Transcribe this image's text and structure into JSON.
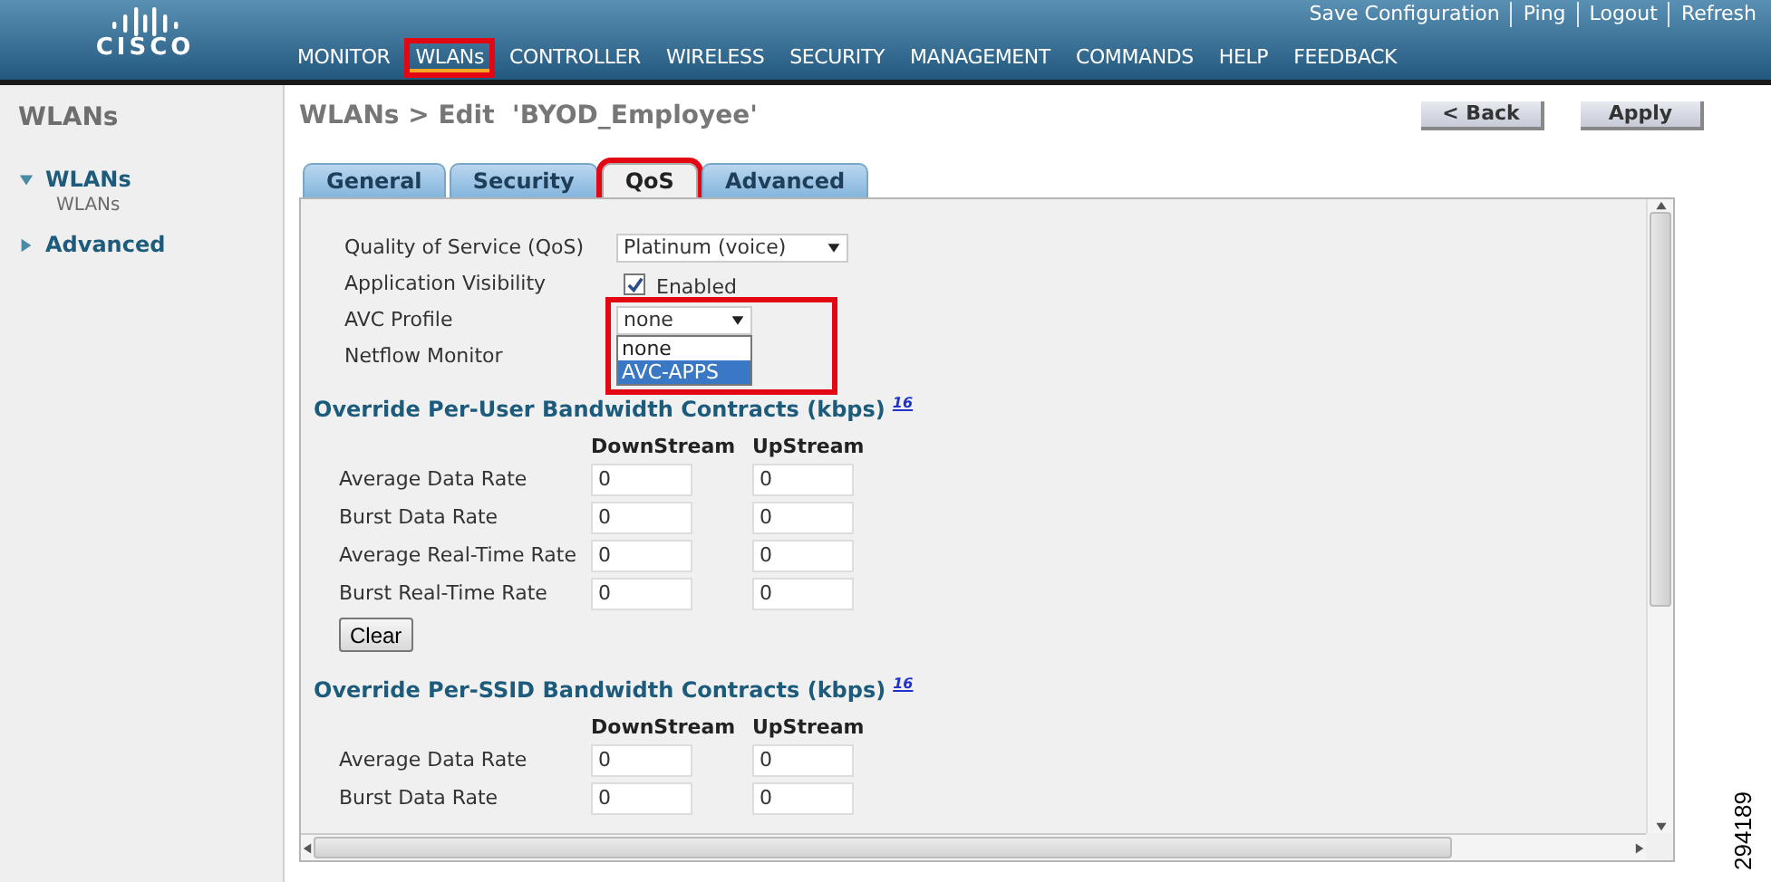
{
  "header": {
    "logo": "CISCO",
    "utility_links": [
      "Save Configuration",
      "Ping",
      "Logout",
      "Refresh"
    ],
    "nav": [
      {
        "label": "MONITOR",
        "selected": false,
        "highlighted": false
      },
      {
        "label": "WLANs",
        "selected": true,
        "highlighted": true
      },
      {
        "label": "CONTROLLER",
        "selected": false,
        "highlighted": false
      },
      {
        "label": "WIRELESS",
        "selected": false,
        "highlighted": false
      },
      {
        "label": "SECURITY",
        "selected": false,
        "highlighted": false
      },
      {
        "label": "MANAGEMENT",
        "selected": false,
        "highlighted": false
      },
      {
        "label": "COMMANDS",
        "selected": false,
        "highlighted": false
      },
      {
        "label": "HELP",
        "selected": false,
        "highlighted": false
      },
      {
        "label": "FEEDBACK",
        "selected": false,
        "highlighted": false
      }
    ]
  },
  "sidebar": {
    "title": "WLANs",
    "items": [
      {
        "label": "WLANs",
        "expanded": true,
        "children": [
          {
            "label": "WLANs"
          }
        ]
      },
      {
        "label": "Advanced",
        "expanded": false
      }
    ]
  },
  "page": {
    "title": "WLANs > Edit  'BYOD_Employee'",
    "buttons": [
      "< Back",
      "Apply"
    ],
    "tabs": [
      {
        "label": "General",
        "selected": false,
        "highlighted": false
      },
      {
        "label": "Security",
        "selected": false,
        "highlighted": false
      },
      {
        "label": "QoS",
        "selected": true,
        "highlighted": true
      },
      {
        "label": "Advanced",
        "selected": false,
        "highlighted": false
      }
    ],
    "form": [
      {
        "kind": "select",
        "label": "Quality of Service (QoS)",
        "value": "Platinum (voice)"
      },
      {
        "kind": "checkbox",
        "label": "Application Visibility",
        "checked": true,
        "text": "Enabled"
      },
      {
        "kind": "select",
        "label": "AVC Profile",
        "value": "none",
        "expanded": true,
        "highlighted": true,
        "options": [
          {
            "label": "none",
            "highlighted": false
          },
          {
            "label": "AVC-APPS",
            "highlighted": true
          }
        ]
      },
      {
        "kind": "covered",
        "label": "Netflow Monitor"
      }
    ],
    "sections": [
      {
        "title": "Override Per-User Bandwidth Contracts (kbps)",
        "note": "16",
        "columns": [
          "DownStream",
          "UpStream"
        ],
        "rows": [
          {
            "label": "Average Data Rate",
            "values": [
              "0",
              "0"
            ]
          },
          {
            "label": "Burst Data Rate",
            "values": [
              "0",
              "0"
            ]
          },
          {
            "label": "Average Real-Time Rate",
            "values": [
              "0",
              "0"
            ]
          },
          {
            "label": "Burst Real-Time Rate",
            "values": [
              "0",
              "0"
            ]
          }
        ],
        "button": "Clear"
      },
      {
        "title": "Override Per-SSID Bandwidth Contracts (kbps)",
        "note": "16",
        "columns": [
          "DownStream",
          "UpStream"
        ],
        "rows": [
          {
            "label": "Average Data Rate",
            "values": [
              "0",
              "0"
            ]
          },
          {
            "label": "Burst Data Rate",
            "values": [
              "0",
              "0"
            ]
          }
        ]
      }
    ]
  },
  "figure_id": "294189"
}
